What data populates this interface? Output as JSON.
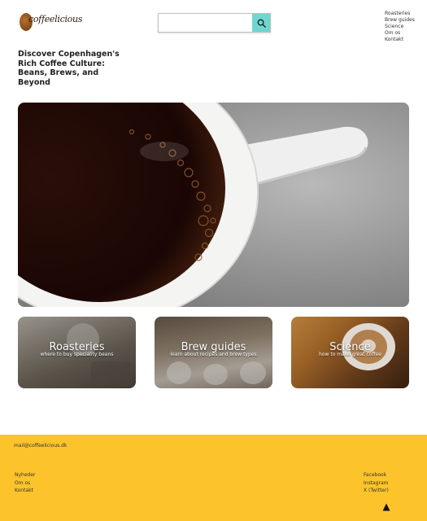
{
  "header": {
    "logo_text": "coffeelicious",
    "search": {
      "placeholder": "",
      "value": ""
    },
    "nav": [
      "Roasteries",
      "Brew guides",
      "Science",
      "Om os",
      "Kontakt"
    ]
  },
  "headline": "Discover Copenhagen's Rich Coffee Culture: Beans, Brews, and Beyond",
  "cards": [
    {
      "title": "Roasteries",
      "subtitle": "where to buy speciality beans"
    },
    {
      "title": "Brew guides",
      "subtitle": "learn about recipes and brew types"
    },
    {
      "title": "Science",
      "subtitle": "how to make great coffee"
    }
  ],
  "footer": {
    "email": "mail@coffeelicious.dk",
    "left_links": [
      "Nyheder",
      "Om os",
      "Kontakt"
    ],
    "right_links": [
      "Facebook",
      "Instagram",
      "X (Twitter)"
    ]
  },
  "colors": {
    "accent": "#6fd6d0",
    "footer_bg": "#fcc42a"
  },
  "icons": {
    "search": "search-icon",
    "to_top": "arrow-up-icon"
  }
}
